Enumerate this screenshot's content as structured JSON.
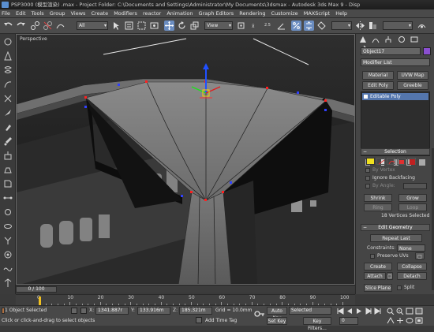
{
  "titlebar": {
    "text": "PSP3000 (模型渲染) .max - Project Folder: C:\\Documents and Settings\\Administrator\\My Documents\\3dsmax - Autodesk 3ds Max 9 - Disp"
  },
  "menu": [
    "File",
    "Edit",
    "Tools",
    "Group",
    "Views",
    "Create",
    "Modifiers",
    "reactor",
    "Animation",
    "Graph Editors",
    "Rendering",
    "Customize",
    "MAXScript",
    "Help"
  ],
  "toolbar": {
    "selection_filter": "All",
    "ref_coord": "View",
    "named_selection": ""
  },
  "viewport": {
    "label": "Perspective"
  },
  "command_panel": {
    "object_name": "Object17",
    "modifier_list": "Modifier List",
    "buttons": {
      "material": "Material",
      "uvw_map": "UVW Map",
      "edit_poly": "Edit Poly",
      "greeble": "Greeble"
    },
    "stack_item": "Editable Poly",
    "selection_rollout": "Selection",
    "by_vertex": "By Vertex",
    "ignore_backfacing": "Ignore Backfacing",
    "by_angle": "By Angle:",
    "shrink": "Shrink",
    "grow": "Grow",
    "ring": "Ring",
    "loop": "Loop",
    "selection_status": "18 Vertices Selected",
    "edit_geometry_rollout": "Edit Geometry",
    "repeat_last": "Repeat Last",
    "constraints_label": "Constraints:",
    "constraints_value": "None",
    "preserve_uvs": "Preserve UVs",
    "create": "Create",
    "collapse": "Collapse",
    "attach": "Attach",
    "detach": "Detach",
    "slice_plane": "Slice Plane",
    "split": "Split"
  },
  "timeline": {
    "slider": "0 / 100",
    "ticks": [
      "0",
      "10",
      "20",
      "30",
      "40",
      "50",
      "60",
      "70",
      "80",
      "90",
      "100"
    ]
  },
  "status": {
    "objects_selected": "1 Object Selected",
    "prompt": "Click or click-and-drag to select objects",
    "x_label": "X:",
    "x_value": "1341.887r",
    "y_label": "Y:",
    "y_value": "133.916m",
    "z_label": "Z:",
    "z_value": "185.321m",
    "grid": "Grid = 10.0mm",
    "add_time_tag": "Add Time Tag",
    "auto_key": "Auto Key",
    "auto_key_value": "Selected",
    "set_key": "Set Key",
    "key_filters": "Key Filters...",
    "frame": "0"
  },
  "colors": {
    "accent": "#5476ad",
    "vertex_selected": "#ff2020",
    "vertex_normal": "#3040ff",
    "gizmo_y": "#20e020",
    "gizmo_z": "#2050ff",
    "gizmo_center": "#ffd000"
  }
}
